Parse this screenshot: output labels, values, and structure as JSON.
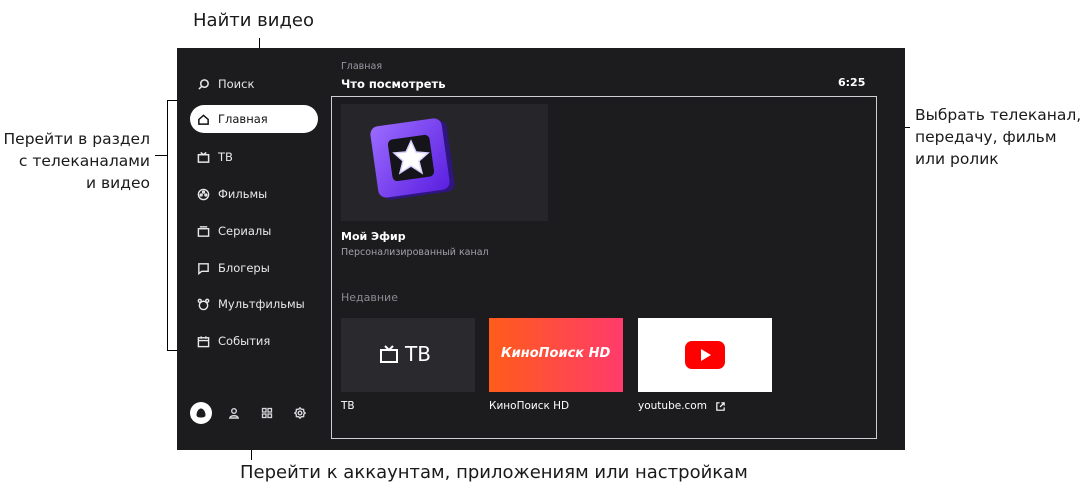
{
  "annotations": {
    "search": "Найти видео",
    "sections": [
      "Перейти в раздел",
      "с телеканалами",
      "и видео"
    ],
    "choose": [
      "Выбрать телеканал,",
      "передачу, фильм",
      "или ролик"
    ],
    "bottom": "Перейти к аккаунтам, приложениям или настройкам"
  },
  "sidebar": {
    "search": {
      "label": "Поиск",
      "icon": "search-icon"
    },
    "items": [
      {
        "label": "Главная",
        "icon": "home-icon",
        "active": true
      },
      {
        "label": "ТВ",
        "icon": "tv-icon"
      },
      {
        "label": "Фильмы",
        "icon": "film-reel-icon"
      },
      {
        "label": "Сериалы",
        "icon": "series-icon"
      },
      {
        "label": "Блогеры",
        "icon": "chat-icon"
      },
      {
        "label": "Мультфильмы",
        "icon": "cartoon-icon"
      },
      {
        "label": "События",
        "icon": "calendar-icon"
      }
    ],
    "bottom_icons": [
      "alisa-icon",
      "account-icon",
      "apps-icon",
      "settings-icon"
    ]
  },
  "header": {
    "breadcrumb": "Главная",
    "title": "Что посмотреть",
    "clock": "6:25"
  },
  "hero": {
    "title": "Мой Эфир",
    "subtitle": "Персонализированный канал"
  },
  "recent": {
    "heading": "Недавние",
    "cards": [
      {
        "label": "ТВ",
        "tile_text": "ТВ",
        "bg": "#2a2a2e"
      },
      {
        "label": "КиноПоиск HD",
        "tile_text": "КиноПоиск HD",
        "bg": "#ff5a2a"
      },
      {
        "label": "youtube.com",
        "tile_text": "",
        "bg": "#ffffff"
      }
    ]
  },
  "colors": {
    "accent_purple": "#7b3ff2",
    "youtube_red": "#ff0000",
    "panel": "#1c1c1f"
  }
}
